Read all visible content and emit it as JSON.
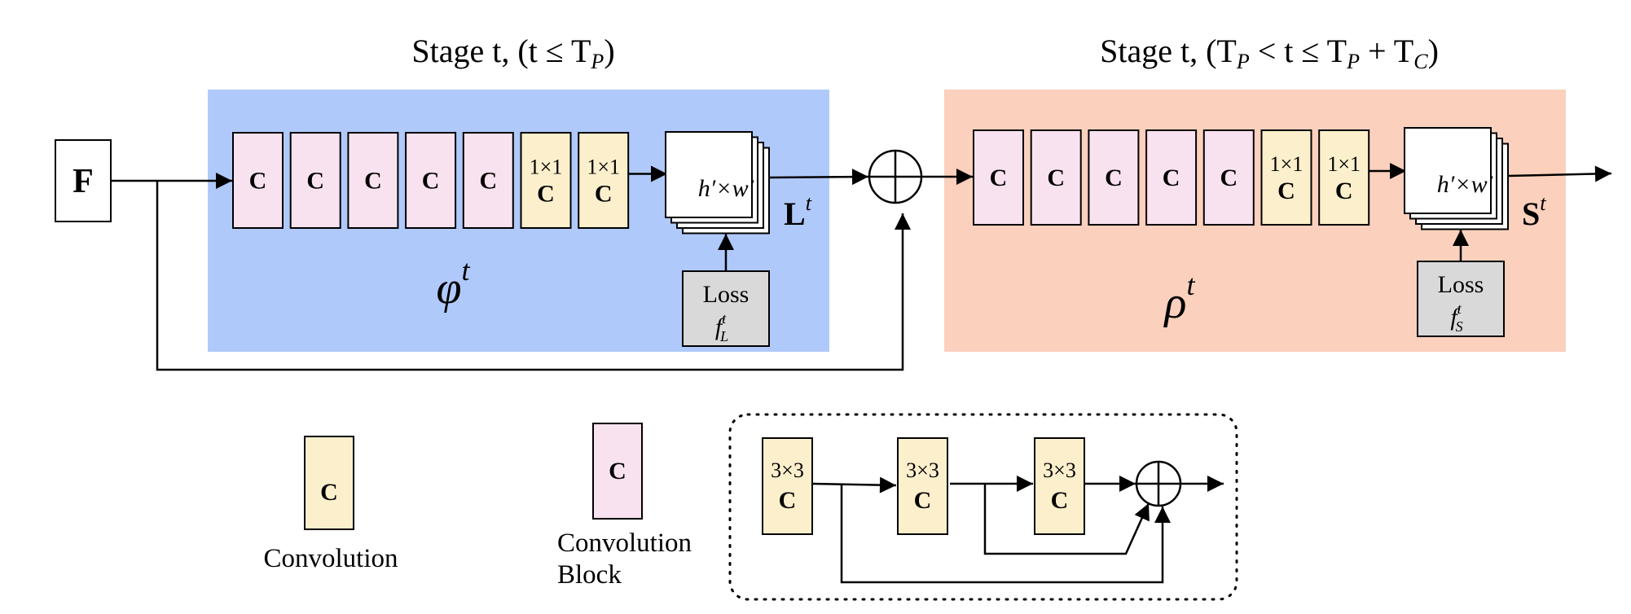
{
  "colors": {
    "stage_p_bg": "#b0c9fb",
    "stage_c_bg": "#fbd0bd",
    "conv_block": "#f9e2ef",
    "conv": "#fcefcc",
    "loss": "#d9d9d9",
    "feature_map": "#ffffff",
    "line": "#000000"
  },
  "input": {
    "label": "F"
  },
  "stage_p": {
    "title": "Stage t, (t ≤ T",
    "title_sub": "P",
    "title_end": ")",
    "network_label": "φ",
    "network_sup": "t",
    "blocks": [
      {
        "type": "conv_block",
        "line1": "",
        "line2": "C"
      },
      {
        "type": "conv_block",
        "line1": "",
        "line2": "C"
      },
      {
        "type": "conv_block",
        "line1": "",
        "line2": "C"
      },
      {
        "type": "conv_block",
        "line1": "",
        "line2": "C"
      },
      {
        "type": "conv_block",
        "line1": "",
        "line2": "C"
      },
      {
        "type": "conv",
        "line1": "1×1",
        "line2": "C"
      },
      {
        "type": "conv",
        "line1": "1×1",
        "line2": "C"
      }
    ],
    "output_map": "h′×w′",
    "output_label": "L",
    "output_sup": "t",
    "loss_label": "Loss",
    "loss_fn": "f",
    "loss_fn_sup": "t",
    "loss_fn_sub": "L"
  },
  "stage_c": {
    "title": "Stage t, (T",
    "title_sub1": "P",
    "title_mid": " < t ≤ T",
    "title_sub2": "P",
    "title_mid2": " + T",
    "title_sub3": "C",
    "title_end": ")",
    "network_label": "ρ",
    "network_sup": "t",
    "blocks": [
      {
        "type": "conv_block",
        "line1": "",
        "line2": "C"
      },
      {
        "type": "conv_block",
        "line1": "",
        "line2": "C"
      },
      {
        "type": "conv_block",
        "line1": "",
        "line2": "C"
      },
      {
        "type": "conv_block",
        "line1": "",
        "line2": "C"
      },
      {
        "type": "conv_block",
        "line1": "",
        "line2": "C"
      },
      {
        "type": "conv",
        "line1": "1×1",
        "line2": "C"
      },
      {
        "type": "conv",
        "line1": "1×1",
        "line2": "C"
      }
    ],
    "output_map": "h′×w′",
    "output_label": "S",
    "output_sup": "t",
    "loss_label": "Loss",
    "loss_fn": "f",
    "loss_fn_sup": "t",
    "loss_fn_sub": "S"
  },
  "legend": {
    "conv": {
      "symbol": "C",
      "label": "Convolution"
    },
    "conv_block": {
      "symbol": "C",
      "label_line1": "Convolution",
      "label_line2": "Block"
    },
    "block_detail": {
      "layers": [
        {
          "line1": "3×3",
          "line2": "C"
        },
        {
          "line1": "3×3",
          "line2": "C"
        },
        {
          "line1": "3×3",
          "line2": "C"
        }
      ]
    }
  }
}
